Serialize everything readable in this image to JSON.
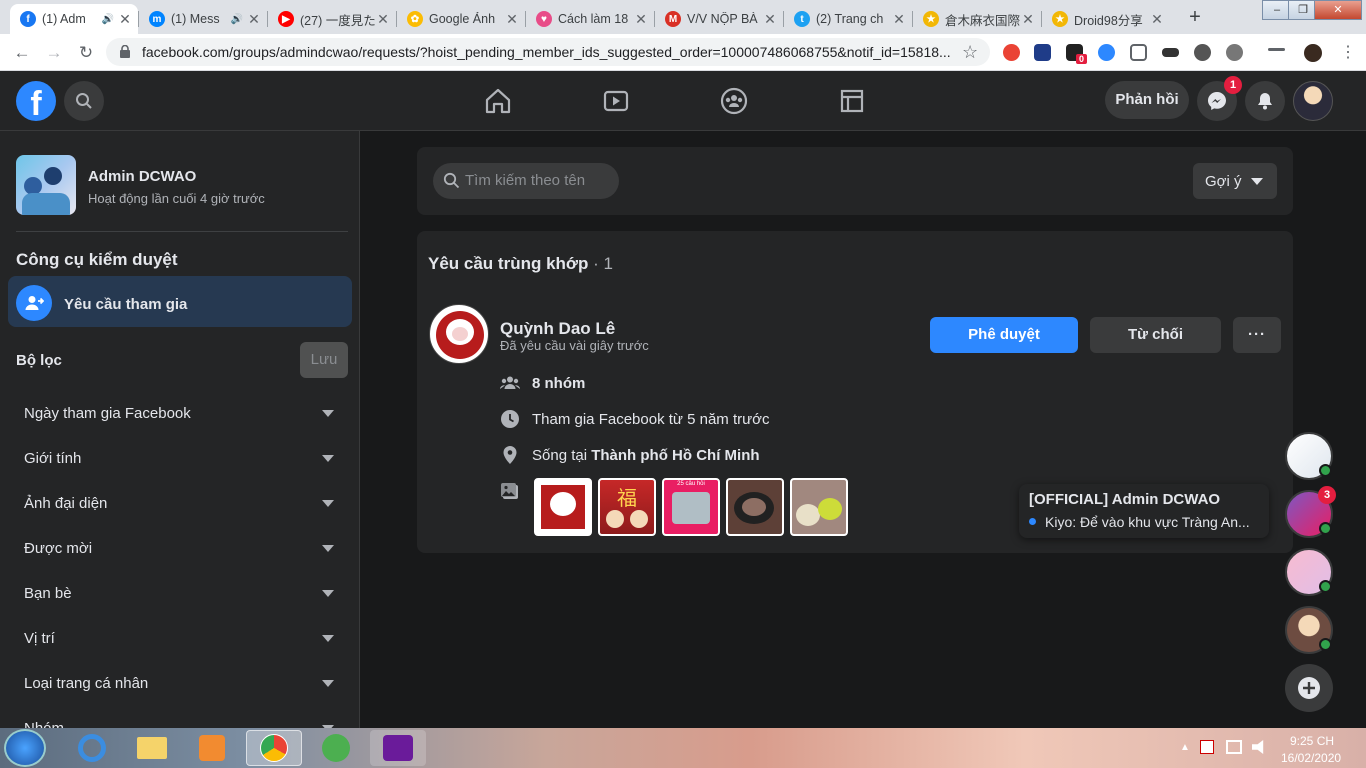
{
  "browser": {
    "tabs": [
      {
        "title": "(1) Adm",
        "icon_color": "#1877f2",
        "icon_name": "facebook-icon",
        "letter": "f",
        "audio": true
      },
      {
        "title": "(1) Mess",
        "icon_color": "#0084ff",
        "icon_name": "messenger-icon",
        "letter": "m",
        "audio": true
      },
      {
        "title": "(27) 一度見た",
        "icon_color": "#ff0000",
        "icon_name": "youtube-icon",
        "letter": "▶",
        "audio": false
      },
      {
        "title": "Google Ảnh",
        "icon_color": "#fbbc04",
        "icon_name": "google-photos-icon",
        "letter": "✿",
        "audio": false
      },
      {
        "title": "Cách làm 18",
        "icon_color": "#e84c88",
        "icon_name": "heart-icon",
        "letter": "♥",
        "audio": false
      },
      {
        "title": "V/V NỘP BÀ",
        "icon_color": "#d93025",
        "icon_name": "gmail-icon",
        "letter": "M",
        "audio": false
      },
      {
        "title": "(2) Trang ch",
        "icon_color": "#1da1f2",
        "icon_name": "twitter-icon",
        "letter": "t",
        "audio": false
      },
      {
        "title": "倉木麻衣国際",
        "icon_color": "#f2b705",
        "icon_name": "trophy-icon",
        "letter": "★",
        "audio": false
      },
      {
        "title": "Droid98分享",
        "icon_color": "#f2b705",
        "icon_name": "trophy-icon",
        "letter": "★",
        "audio": false
      }
    ],
    "url": "facebook.com/groups/admindcwao/requests/?hoist_pending_member_ids_suggested_order=100007486068755&notif_id=15818...",
    "ext_badge": "0"
  },
  "header": {
    "feedback_label": "Phản hồi",
    "messenger_badge": "1"
  },
  "sidebar": {
    "group_name": "Admin DCWAO",
    "group_activity": "Hoạt động lần cuối 4 giờ trước",
    "tools_title": "Công cụ kiểm duyệt",
    "active_item": "Yêu cầu tham gia",
    "filter_title": "Bộ lọc",
    "save_label": "Lưu",
    "filters": [
      "Ngày tham gia Facebook",
      "Giới tính",
      "Ảnh đại diện",
      "Được mời",
      "Bạn bè",
      "Vị trí",
      "Loại trang cá nhân",
      "Nhóm"
    ]
  },
  "main": {
    "search_placeholder": "Tìm kiếm theo tên",
    "sort_label": "Gợi ý",
    "section_title": "Yêu cầu trùng khớp",
    "section_count": " · 1",
    "request": {
      "name": "Quỳnh Dao Lê",
      "time": "Đã yêu cầu vài giây trước",
      "approve_label": "Phê duyệt",
      "decline_label": "Từ chối",
      "more_label": "···",
      "groups": "8 nhóm",
      "joined": "Tham gia Facebook từ 5 năm trước",
      "lives_prefix": "Sống tại ",
      "lives_city": "Thành phố Hồ Chí Minh",
      "thumb2_text": "福",
      "thumb3_text": "25 câu hỏi"
    }
  },
  "chat": {
    "popup_title": "[OFFICIAL] Admin DCWAO",
    "popup_message": "Kiyo: Để vào khu vực Tràng An...",
    "head2_badge": "3"
  },
  "taskbar": {
    "time": "9:25 CH",
    "date": "16/02/2020"
  }
}
